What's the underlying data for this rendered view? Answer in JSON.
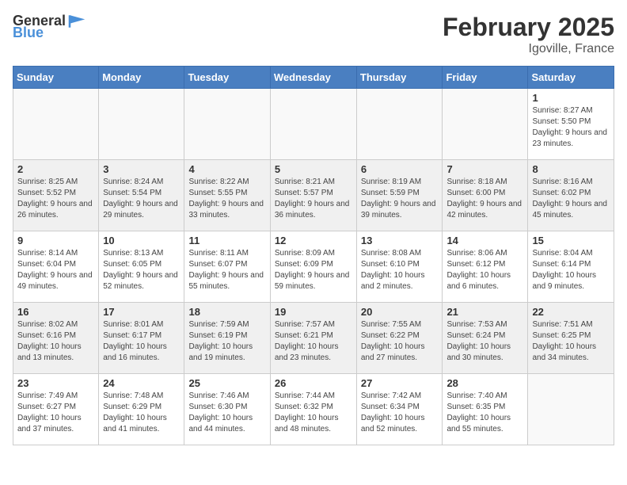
{
  "header": {
    "logo_general": "General",
    "logo_blue": "Blue",
    "month_year": "February 2025",
    "location": "Igoville, France"
  },
  "days_of_week": [
    "Sunday",
    "Monday",
    "Tuesday",
    "Wednesday",
    "Thursday",
    "Friday",
    "Saturday"
  ],
  "weeks": [
    {
      "days": [
        {
          "num": "",
          "info": ""
        },
        {
          "num": "",
          "info": ""
        },
        {
          "num": "",
          "info": ""
        },
        {
          "num": "",
          "info": ""
        },
        {
          "num": "",
          "info": ""
        },
        {
          "num": "",
          "info": ""
        },
        {
          "num": "1",
          "info": "Sunrise: 8:27 AM\nSunset: 5:50 PM\nDaylight: 9 hours and 23 minutes."
        }
      ]
    },
    {
      "days": [
        {
          "num": "2",
          "info": "Sunrise: 8:25 AM\nSunset: 5:52 PM\nDaylight: 9 hours and 26 minutes."
        },
        {
          "num": "3",
          "info": "Sunrise: 8:24 AM\nSunset: 5:54 PM\nDaylight: 9 hours and 29 minutes."
        },
        {
          "num": "4",
          "info": "Sunrise: 8:22 AM\nSunset: 5:55 PM\nDaylight: 9 hours and 33 minutes."
        },
        {
          "num": "5",
          "info": "Sunrise: 8:21 AM\nSunset: 5:57 PM\nDaylight: 9 hours and 36 minutes."
        },
        {
          "num": "6",
          "info": "Sunrise: 8:19 AM\nSunset: 5:59 PM\nDaylight: 9 hours and 39 minutes."
        },
        {
          "num": "7",
          "info": "Sunrise: 8:18 AM\nSunset: 6:00 PM\nDaylight: 9 hours and 42 minutes."
        },
        {
          "num": "8",
          "info": "Sunrise: 8:16 AM\nSunset: 6:02 PM\nDaylight: 9 hours and 45 minutes."
        }
      ]
    },
    {
      "days": [
        {
          "num": "9",
          "info": "Sunrise: 8:14 AM\nSunset: 6:04 PM\nDaylight: 9 hours and 49 minutes."
        },
        {
          "num": "10",
          "info": "Sunrise: 8:13 AM\nSunset: 6:05 PM\nDaylight: 9 hours and 52 minutes."
        },
        {
          "num": "11",
          "info": "Sunrise: 8:11 AM\nSunset: 6:07 PM\nDaylight: 9 hours and 55 minutes."
        },
        {
          "num": "12",
          "info": "Sunrise: 8:09 AM\nSunset: 6:09 PM\nDaylight: 9 hours and 59 minutes."
        },
        {
          "num": "13",
          "info": "Sunrise: 8:08 AM\nSunset: 6:10 PM\nDaylight: 10 hours and 2 minutes."
        },
        {
          "num": "14",
          "info": "Sunrise: 8:06 AM\nSunset: 6:12 PM\nDaylight: 10 hours and 6 minutes."
        },
        {
          "num": "15",
          "info": "Sunrise: 8:04 AM\nSunset: 6:14 PM\nDaylight: 10 hours and 9 minutes."
        }
      ]
    },
    {
      "days": [
        {
          "num": "16",
          "info": "Sunrise: 8:02 AM\nSunset: 6:16 PM\nDaylight: 10 hours and 13 minutes."
        },
        {
          "num": "17",
          "info": "Sunrise: 8:01 AM\nSunset: 6:17 PM\nDaylight: 10 hours and 16 minutes."
        },
        {
          "num": "18",
          "info": "Sunrise: 7:59 AM\nSunset: 6:19 PM\nDaylight: 10 hours and 19 minutes."
        },
        {
          "num": "19",
          "info": "Sunrise: 7:57 AM\nSunset: 6:21 PM\nDaylight: 10 hours and 23 minutes."
        },
        {
          "num": "20",
          "info": "Sunrise: 7:55 AM\nSunset: 6:22 PM\nDaylight: 10 hours and 27 minutes."
        },
        {
          "num": "21",
          "info": "Sunrise: 7:53 AM\nSunset: 6:24 PM\nDaylight: 10 hours and 30 minutes."
        },
        {
          "num": "22",
          "info": "Sunrise: 7:51 AM\nSunset: 6:25 PM\nDaylight: 10 hours and 34 minutes."
        }
      ]
    },
    {
      "days": [
        {
          "num": "23",
          "info": "Sunrise: 7:49 AM\nSunset: 6:27 PM\nDaylight: 10 hours and 37 minutes."
        },
        {
          "num": "24",
          "info": "Sunrise: 7:48 AM\nSunset: 6:29 PM\nDaylight: 10 hours and 41 minutes."
        },
        {
          "num": "25",
          "info": "Sunrise: 7:46 AM\nSunset: 6:30 PM\nDaylight: 10 hours and 44 minutes."
        },
        {
          "num": "26",
          "info": "Sunrise: 7:44 AM\nSunset: 6:32 PM\nDaylight: 10 hours and 48 minutes."
        },
        {
          "num": "27",
          "info": "Sunrise: 7:42 AM\nSunset: 6:34 PM\nDaylight: 10 hours and 52 minutes."
        },
        {
          "num": "28",
          "info": "Sunrise: 7:40 AM\nSunset: 6:35 PM\nDaylight: 10 hours and 55 minutes."
        },
        {
          "num": "",
          "info": ""
        }
      ]
    }
  ]
}
